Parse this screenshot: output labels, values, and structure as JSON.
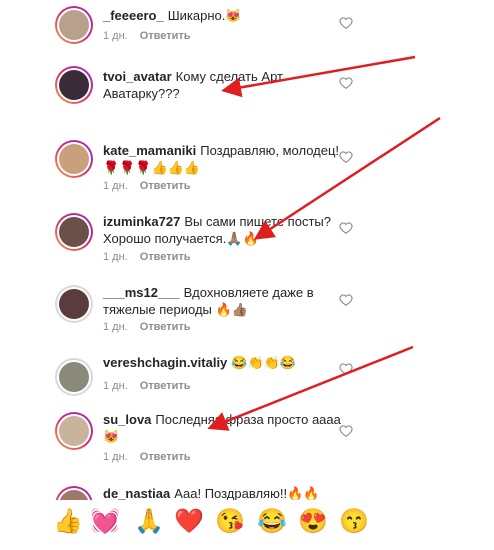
{
  "comments": [
    {
      "user": "_feeeero_",
      "text": "Шикарно.😻",
      "time": "1 дн.",
      "reply": "Ответить"
    },
    {
      "user": "tvoi_avatar",
      "text": "Кому сделать Арт Аватарку???",
      "time": "",
      "reply": ""
    },
    {
      "user": "kate_mamaniki",
      "text": "Поздравляю, молодец!🌹🌹🌹👍👍👍",
      "time": "1 дн.",
      "reply": "Ответить"
    },
    {
      "user": "izuminka727",
      "text": "Вы сами пишете посты? Хорошо получается.🙏🏽🔥",
      "time": "1 дн.",
      "reply": "Ответить"
    },
    {
      "user": "___ms12___",
      "text": "Вдохновляете даже в тяжелые периоды 🔥👍🏽",
      "time": "1 дн.",
      "reply": "Ответить"
    },
    {
      "user": "vereshchagin.vitaliy",
      "text": "😂👏👏😂",
      "time": "1 дн.",
      "reply": "Ответить"
    },
    {
      "user": "su_lova",
      "text": "Последняя фраза просто аааа😻",
      "time": "1 дн.",
      "reply": "Ответить"
    },
    {
      "user": "de_nastiaa",
      "text": "Ааа! Поздравляю!!🔥🔥",
      "time": "",
      "reply": ""
    }
  ],
  "emoji_bar": [
    "👍",
    "💓",
    "🙏",
    "❤️",
    "😘",
    "😂",
    "😍",
    "😙"
  ],
  "colors": {
    "arrow": "#e01e1e",
    "text": "#262626",
    "meta": "#8e8e8e"
  }
}
